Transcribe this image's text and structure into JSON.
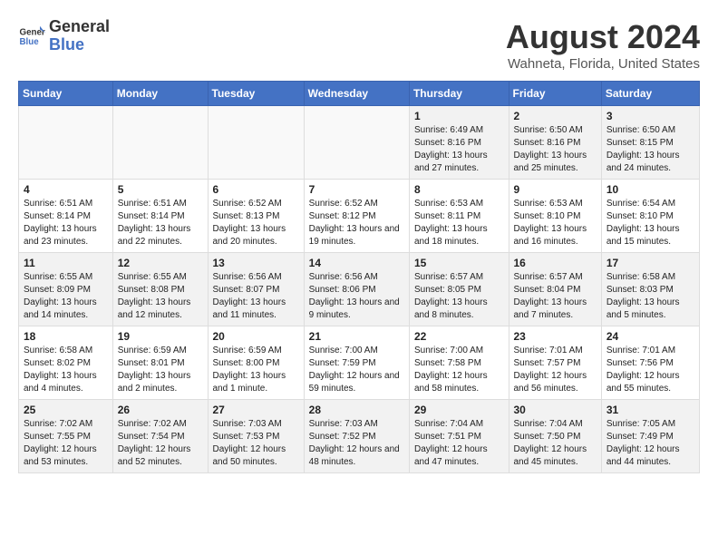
{
  "header": {
    "logo_line1": "General",
    "logo_line2": "Blue",
    "main_title": "August 2024",
    "subtitle": "Wahneta, Florida, United States"
  },
  "weekdays": [
    "Sunday",
    "Monday",
    "Tuesday",
    "Wednesday",
    "Thursday",
    "Friday",
    "Saturday"
  ],
  "weeks": [
    [
      {
        "day": "",
        "empty": true
      },
      {
        "day": "",
        "empty": true
      },
      {
        "day": "",
        "empty": true
      },
      {
        "day": "",
        "empty": true
      },
      {
        "day": "1",
        "sunrise": "6:49 AM",
        "sunset": "8:16 PM",
        "daylight": "13 hours and 27 minutes."
      },
      {
        "day": "2",
        "sunrise": "6:50 AM",
        "sunset": "8:16 PM",
        "daylight": "13 hours and 25 minutes."
      },
      {
        "day": "3",
        "sunrise": "6:50 AM",
        "sunset": "8:15 PM",
        "daylight": "13 hours and 24 minutes."
      }
    ],
    [
      {
        "day": "4",
        "sunrise": "6:51 AM",
        "sunset": "8:14 PM",
        "daylight": "13 hours and 23 minutes."
      },
      {
        "day": "5",
        "sunrise": "6:51 AM",
        "sunset": "8:14 PM",
        "daylight": "13 hours and 22 minutes."
      },
      {
        "day": "6",
        "sunrise": "6:52 AM",
        "sunset": "8:13 PM",
        "daylight": "13 hours and 20 minutes."
      },
      {
        "day": "7",
        "sunrise": "6:52 AM",
        "sunset": "8:12 PM",
        "daylight": "13 hours and 19 minutes."
      },
      {
        "day": "8",
        "sunrise": "6:53 AM",
        "sunset": "8:11 PM",
        "daylight": "13 hours and 18 minutes."
      },
      {
        "day": "9",
        "sunrise": "6:53 AM",
        "sunset": "8:10 PM",
        "daylight": "13 hours and 16 minutes."
      },
      {
        "day": "10",
        "sunrise": "6:54 AM",
        "sunset": "8:10 PM",
        "daylight": "13 hours and 15 minutes."
      }
    ],
    [
      {
        "day": "11",
        "sunrise": "6:55 AM",
        "sunset": "8:09 PM",
        "daylight": "13 hours and 14 minutes."
      },
      {
        "day": "12",
        "sunrise": "6:55 AM",
        "sunset": "8:08 PM",
        "daylight": "13 hours and 12 minutes."
      },
      {
        "day": "13",
        "sunrise": "6:56 AM",
        "sunset": "8:07 PM",
        "daylight": "13 hours and 11 minutes."
      },
      {
        "day": "14",
        "sunrise": "6:56 AM",
        "sunset": "8:06 PM",
        "daylight": "13 hours and 9 minutes."
      },
      {
        "day": "15",
        "sunrise": "6:57 AM",
        "sunset": "8:05 PM",
        "daylight": "13 hours and 8 minutes."
      },
      {
        "day": "16",
        "sunrise": "6:57 AM",
        "sunset": "8:04 PM",
        "daylight": "13 hours and 7 minutes."
      },
      {
        "day": "17",
        "sunrise": "6:58 AM",
        "sunset": "8:03 PM",
        "daylight": "13 hours and 5 minutes."
      }
    ],
    [
      {
        "day": "18",
        "sunrise": "6:58 AM",
        "sunset": "8:02 PM",
        "daylight": "13 hours and 4 minutes."
      },
      {
        "day": "19",
        "sunrise": "6:59 AM",
        "sunset": "8:01 PM",
        "daylight": "13 hours and 2 minutes."
      },
      {
        "day": "20",
        "sunrise": "6:59 AM",
        "sunset": "8:00 PM",
        "daylight": "13 hours and 1 minute."
      },
      {
        "day": "21",
        "sunrise": "7:00 AM",
        "sunset": "7:59 PM",
        "daylight": "12 hours and 59 minutes."
      },
      {
        "day": "22",
        "sunrise": "7:00 AM",
        "sunset": "7:58 PM",
        "daylight": "12 hours and 58 minutes."
      },
      {
        "day": "23",
        "sunrise": "7:01 AM",
        "sunset": "7:57 PM",
        "daylight": "12 hours and 56 minutes."
      },
      {
        "day": "24",
        "sunrise": "7:01 AM",
        "sunset": "7:56 PM",
        "daylight": "12 hours and 55 minutes."
      }
    ],
    [
      {
        "day": "25",
        "sunrise": "7:02 AM",
        "sunset": "7:55 PM",
        "daylight": "12 hours and 53 minutes."
      },
      {
        "day": "26",
        "sunrise": "7:02 AM",
        "sunset": "7:54 PM",
        "daylight": "12 hours and 52 minutes."
      },
      {
        "day": "27",
        "sunrise": "7:03 AM",
        "sunset": "7:53 PM",
        "daylight": "12 hours and 50 minutes."
      },
      {
        "day": "28",
        "sunrise": "7:03 AM",
        "sunset": "7:52 PM",
        "daylight": "12 hours and 48 minutes."
      },
      {
        "day": "29",
        "sunrise": "7:04 AM",
        "sunset": "7:51 PM",
        "daylight": "12 hours and 47 minutes."
      },
      {
        "day": "30",
        "sunrise": "7:04 AM",
        "sunset": "7:50 PM",
        "daylight": "12 hours and 45 minutes."
      },
      {
        "day": "31",
        "sunrise": "7:05 AM",
        "sunset": "7:49 PM",
        "daylight": "12 hours and 44 minutes."
      }
    ]
  ],
  "labels": {
    "sunrise": "Sunrise:",
    "sunset": "Sunset:",
    "daylight": "Daylight:"
  }
}
